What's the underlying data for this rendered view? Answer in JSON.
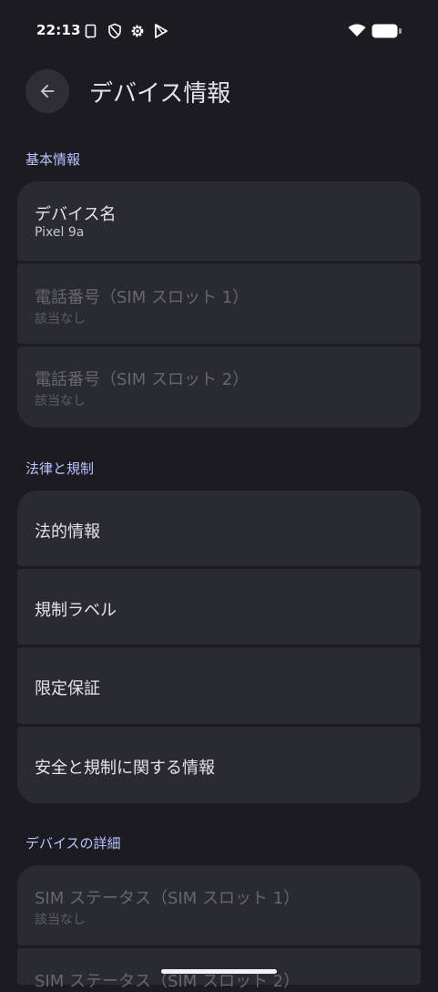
{
  "status_bar": {
    "time": "22:13"
  },
  "header": {
    "title": "デバイス情報"
  },
  "sections": {
    "basic": {
      "header": "基本情報",
      "items": [
        {
          "title": "デバイス名",
          "subtitle": "Pixel 9a"
        },
        {
          "title": "電話番号（SIM スロット 1）",
          "subtitle": "該当なし"
        },
        {
          "title": "電話番号（SIM スロット 2）",
          "subtitle": "該当なし"
        }
      ]
    },
    "legal": {
      "header": "法律と規制",
      "items": [
        {
          "title": "法的情報"
        },
        {
          "title": "規制ラベル"
        },
        {
          "title": "限定保証"
        },
        {
          "title": "安全と規制に関する情報"
        }
      ]
    },
    "details": {
      "header": "デバイスの詳細",
      "items": [
        {
          "title": "SIM ステータス（SIM スロット 1）",
          "subtitle": "該当なし"
        },
        {
          "title": "SIM ステータス（SIM スロット 2）"
        }
      ]
    }
  },
  "icons": {
    "back": "arrow-back-icon",
    "status_left": [
      "screenshot-icon",
      "vpn-shield-icon",
      "settings-gear-icon",
      "play-store-icon"
    ],
    "status_right": [
      "wifi-icon",
      "battery-icon"
    ]
  },
  "colors": {
    "background": "#1b1b21",
    "card": "#2a2a33",
    "accent": "#b9c3ff",
    "disabled_text": "#676670"
  }
}
